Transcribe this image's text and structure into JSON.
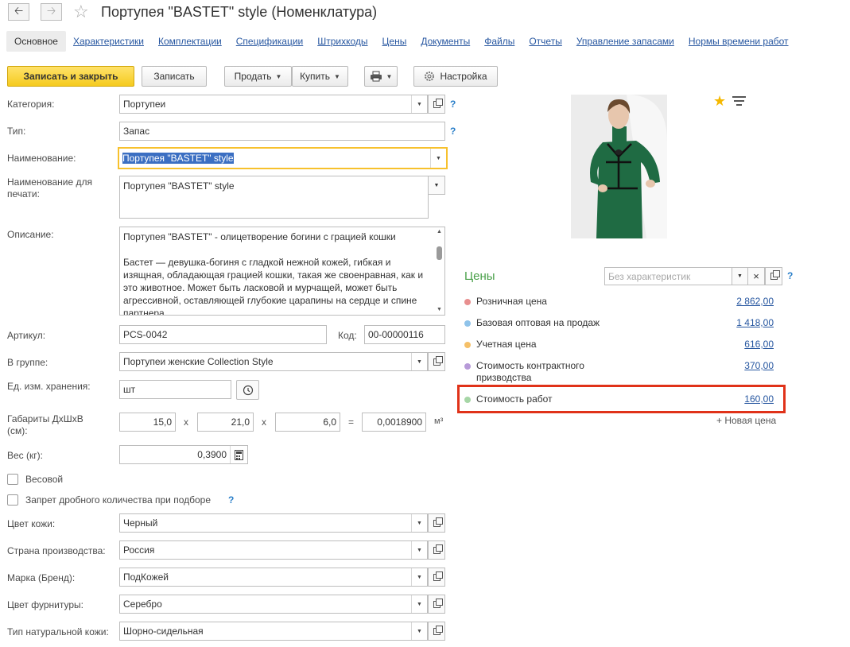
{
  "window": {
    "title": "Портупея \"BASTET\" style (Номенклатура)",
    "back_icon": "arrow-left-icon",
    "forward_icon": "arrow-right-icon",
    "favorite_icon": "star-outline-icon"
  },
  "tabs": [
    {
      "label": "Основное",
      "active": true
    },
    {
      "label": "Характеристики"
    },
    {
      "label": "Комплектации"
    },
    {
      "label": "Спецификации"
    },
    {
      "label": "Штрихкоды"
    },
    {
      "label": "Цены"
    },
    {
      "label": "Документы"
    },
    {
      "label": "Файлы"
    },
    {
      "label": "Отчеты"
    },
    {
      "label": "Управление запасами"
    },
    {
      "label": "Нормы времени работ"
    }
  ],
  "toolbar": {
    "save_close": "Записать и закрыть",
    "save": "Записать",
    "sell": "Продать",
    "buy": "Купить",
    "settings": "Настройка",
    "print_icon": "printer-icon",
    "settings_icon": "gear-icon"
  },
  "form": {
    "category_label": "Категория:",
    "category_value": "Портупеи",
    "type_label": "Тип:",
    "type_value": "Запас",
    "name_label": "Наименование:",
    "name_value": "Портупея \"BASTET\" style",
    "print_name_label": "Наименование для печати:",
    "print_name_value": "Портупея \"BASTET\" style",
    "description_label": "Описание:",
    "description_value": "Портупея \"BASTET\" - олицетворение богини с грацией кошки\n\nБастет — девушка-богиня с гладкой нежной кожей, гибкая и изящная, обладающая грацией кошки, такая же своенравная, как и это животное. Может быть ласковой и мурчащей, может быть агрессивной, оставляющей глубокие царапины на сердце и спине партнера",
    "article_label": "Артикул:",
    "article_value": "PCS-0042",
    "code_label": "Код:",
    "code_value": "00-00000116",
    "group_label": "В группе:",
    "group_value": "Портупеи женские Collection Style",
    "unit_label": "Ед. изм. хранения:",
    "unit_value": "шт",
    "dims_label": "Габариты ДхШхВ (см):",
    "dim_l": "15,0",
    "dim_w": "21,0",
    "dim_h": "6,0",
    "dims_x": "x",
    "dims_eq": "=",
    "volume": "0,0018900",
    "volume_unit": "м³",
    "weight_label": "Вес (кг):",
    "weight_value": "0,3900",
    "weighted_label": "Весовой",
    "fraction_label": "Запрет дробного количества при подборе",
    "skin_color_label": "Цвет кожи:",
    "skin_color_value": "Черный",
    "country_label": "Страна производства:",
    "country_value": "Россия",
    "brand_label": "Марка (Бренд):",
    "brand_value": "ПодКожей",
    "fittings_label": "Цвет фурнитуры:",
    "fittings_value": "Серебро",
    "leather_type_label": "Тип натуральной кожи:",
    "leather_type_value": "Шорно-сидельная",
    "help": "?"
  },
  "prices": {
    "title": "Цены",
    "characteristic_placeholder": "Без характеристик",
    "clear": "×",
    "rows": [
      {
        "name": "Розничная цена",
        "value": "2 862,00",
        "color": "#e88f8f"
      },
      {
        "name": "Базовая оптовая на продаж",
        "value": "1 418,00",
        "color": "#8fc3ea"
      },
      {
        "name": "Учетная цена",
        "value": "616,00",
        "color": "#f5c068"
      },
      {
        "name": "Стоимость контрактного призводства",
        "value": "370,00",
        "color": "#b79ad8"
      },
      {
        "name": "Стоимость работ",
        "value": "160,00",
        "color": "#a6d6a6"
      }
    ],
    "new_price": "+ Новая цена"
  },
  "colors": {
    "accent_yellow": "#f5cb1f",
    "link_blue": "#2656a0",
    "highlight_red": "#e03219",
    "prices_green": "#4aa04a"
  }
}
